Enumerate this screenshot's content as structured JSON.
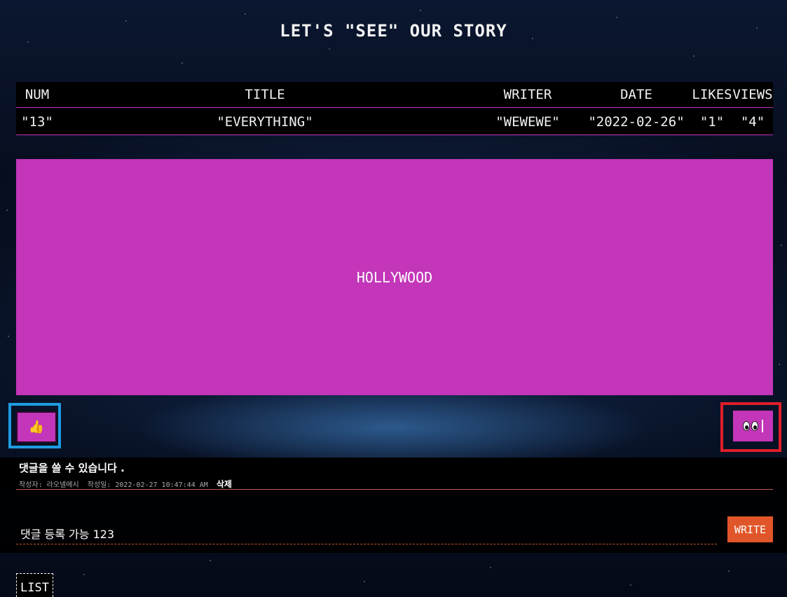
{
  "page": {
    "title": "LET'S \"SEE\" OUR STORY"
  },
  "table": {
    "headers": {
      "num": "NUM",
      "title": "TITLE",
      "writer": "WRITER",
      "date": "DATE",
      "likes": "LIKES",
      "views": "VIEWS"
    },
    "row": {
      "num": "\"13\"",
      "title": "\"EVERYTHING\"",
      "writer": "\"WEWEWE\"",
      "date": "\"2022-02-26\"",
      "likes": "\"1\"",
      "views": "\"4\""
    }
  },
  "content": {
    "body": "HOLLYWOOD"
  },
  "actions": {
    "like_icon": "thumbs-up-icon",
    "like_glyph": "👍",
    "views_icon": "eyes-icon"
  },
  "comment": {
    "text": "댓글을 쓸 수 있습니다 .",
    "author": "작성자: 라오넬메시",
    "date": "작성일: 2022-02-27 10:47:44 AM",
    "delete_label": "삭제"
  },
  "comment_form": {
    "value": "댓글 등록 가능 123",
    "write_label": "WRITE"
  },
  "nav": {
    "list_label": "LIST"
  },
  "colors": {
    "accent": "#c335b9",
    "write_button": "#e0562a",
    "highlight_blue": "#1e9be0",
    "highlight_red": "#e01e2a"
  }
}
